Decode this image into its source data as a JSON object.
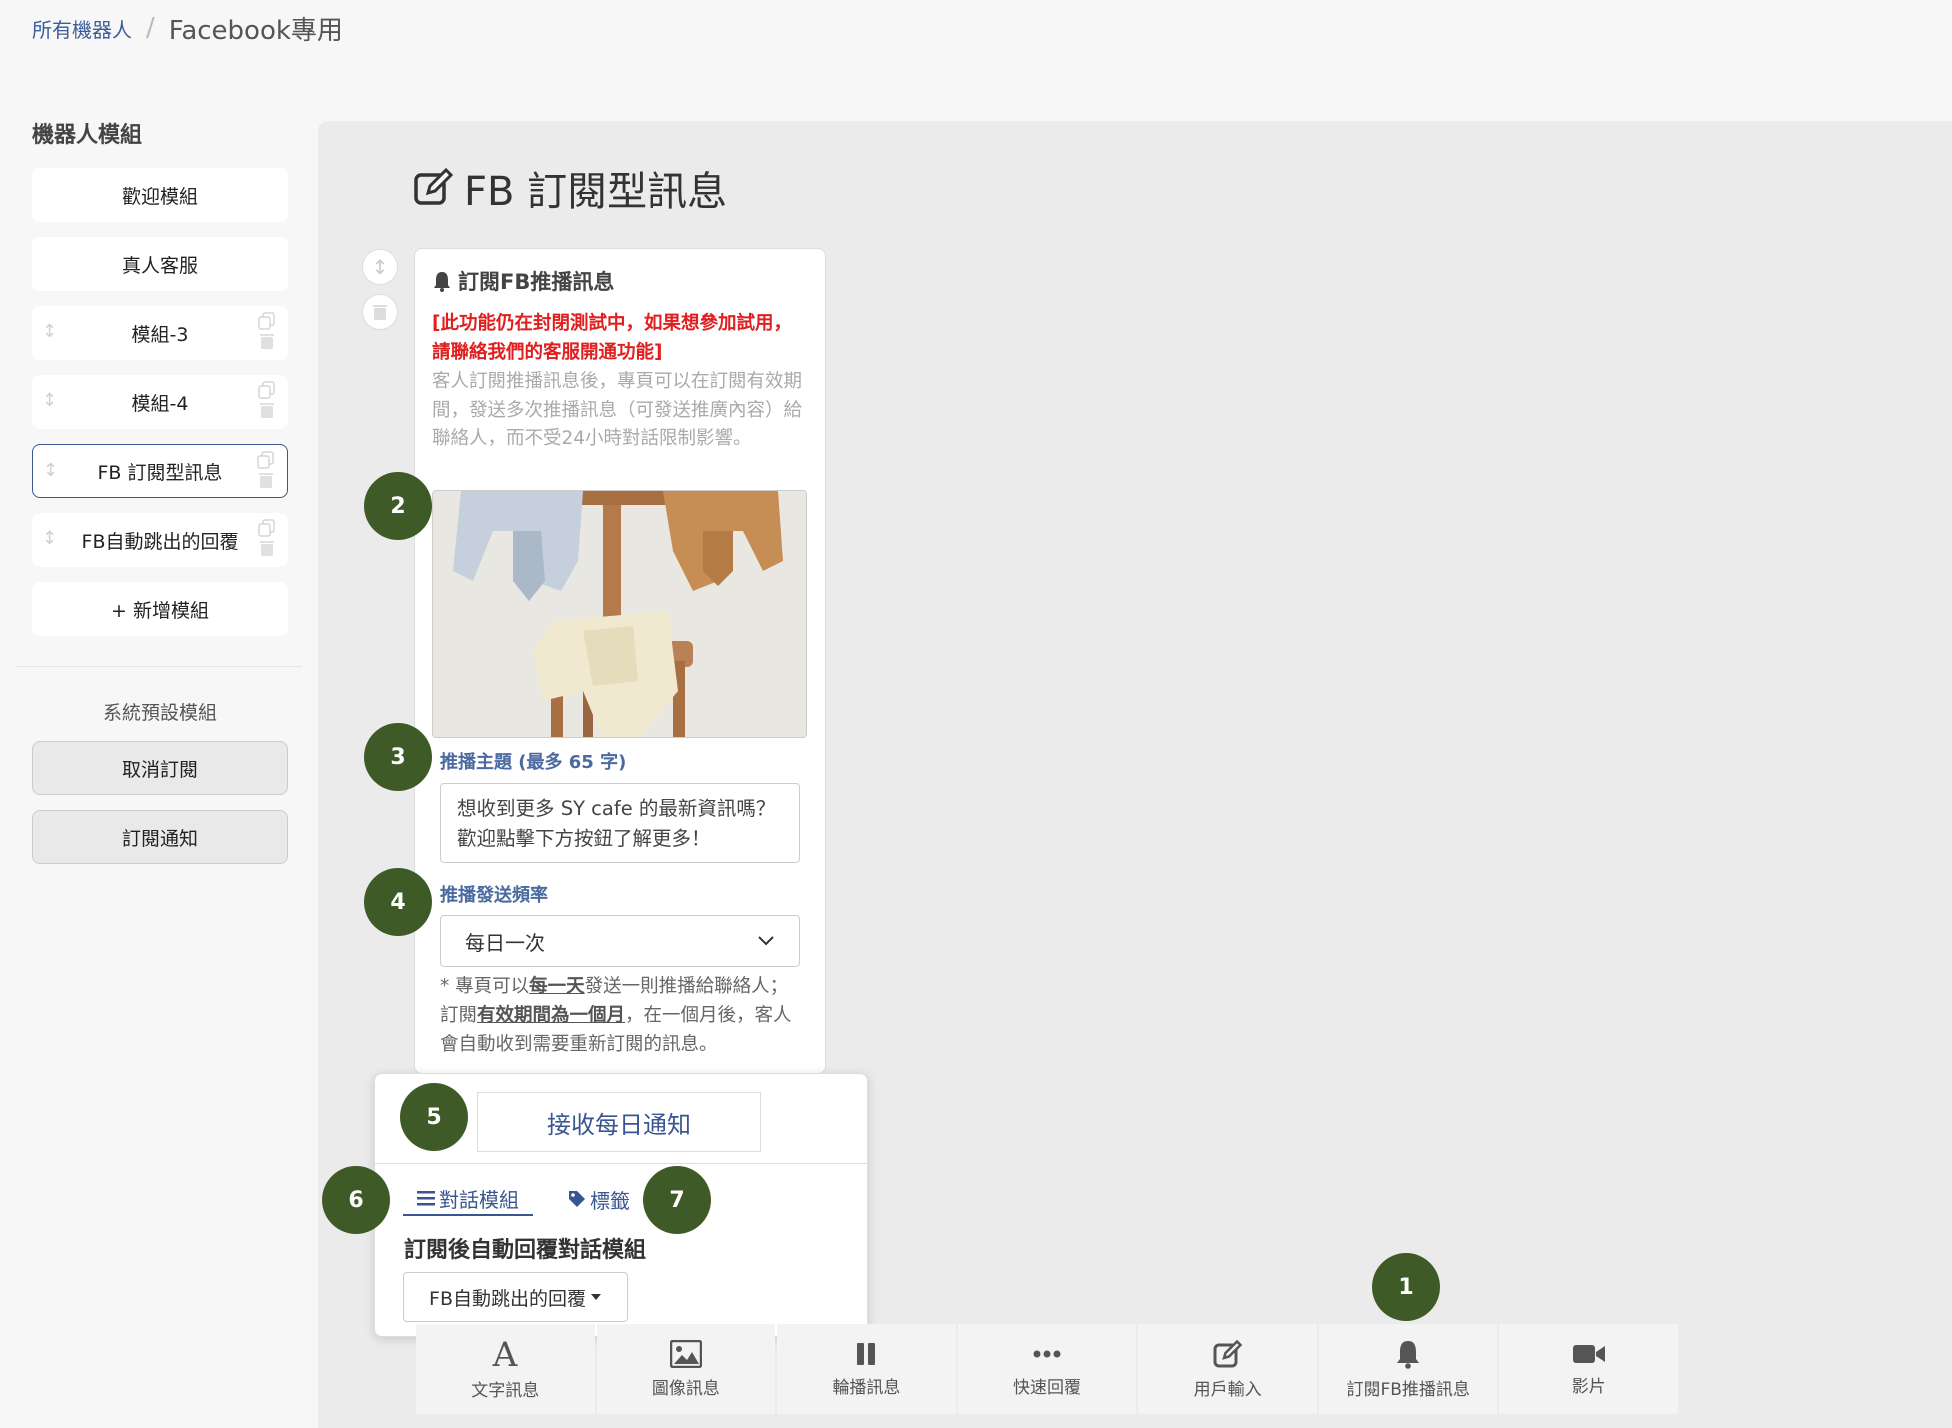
{
  "breadcrumb": {
    "root": "所有機器人",
    "separator": "/",
    "current": "Facebook專用"
  },
  "sidebar": {
    "title": "機器人模組",
    "modules": [
      {
        "label": "歡迎模組"
      },
      {
        "label": "真人客服"
      },
      {
        "label": "模組-3"
      },
      {
        "label": "模組-4"
      },
      {
        "label": "FB 訂閱型訊息",
        "active": true
      },
      {
        "label": "FB自動跳出的回覆"
      }
    ],
    "add_label": "+ 新增模組",
    "system_title": "系統預設模組",
    "system_modules": [
      {
        "label": "取消訂閱"
      },
      {
        "label": "訂閱通知"
      }
    ]
  },
  "page": {
    "title": "FB 訂閱型訊息",
    "title_icon": "edit-icon"
  },
  "card": {
    "header": "訂閱FB推播訊息",
    "header_icon": "bell-icon",
    "warning": "[此功能仍在封閉測試中，如果想參加試用，請聯絡我們的客服開通功能]",
    "description": "客人訂閱推播訊息後，專頁可以在訂閱有效期間，發送多次推播訊息（可發送推廣內容）給聯絡人，而不受24小時對話限制影響。",
    "topic_label": "推播主題 (最多 65 字)",
    "topic_value": "想收到更多 SY cafe 的最新資訊嗎？歡迎點擊下方按鈕了解更多！",
    "frequency_label": "推播發送頻率",
    "frequency_value": "每日一次",
    "note_parts": [
      "* 專頁可以",
      "每一天",
      "發送一則推播給聯絡人；訂閱",
      "有效期間為一個月",
      "，在一個月後，客人會自動收到需要重新訂閱的訊息。"
    ]
  },
  "popup": {
    "receive_button": "接收每日通知",
    "tabs": [
      {
        "label": "對話模組",
        "icon": "list-icon"
      },
      {
        "label": "標籤",
        "icon": "tag-icon"
      }
    ],
    "reply_label": "訂閱後自動回覆對話模組",
    "reply_module": "FB自動跳出的回覆"
  },
  "toolbar": [
    {
      "label": "文字訊息",
      "icon": "text-icon"
    },
    {
      "label": "圖像訊息",
      "icon": "image-icon"
    },
    {
      "label": "輪播訊息",
      "icon": "carousel-icon"
    },
    {
      "label": "快速回覆",
      "icon": "ellipsis-icon"
    },
    {
      "label": "用戶輸入",
      "icon": "edit-icon"
    },
    {
      "label": "訂閱FB推播訊息",
      "icon": "bell-icon"
    },
    {
      "label": "影片",
      "icon": "video-icon"
    }
  ],
  "markers": [
    "1",
    "2",
    "3",
    "4",
    "5",
    "6",
    "7"
  ],
  "colors": {
    "accent": "#3a5690",
    "marker": "#3e5a26",
    "warning": "#e02020"
  }
}
